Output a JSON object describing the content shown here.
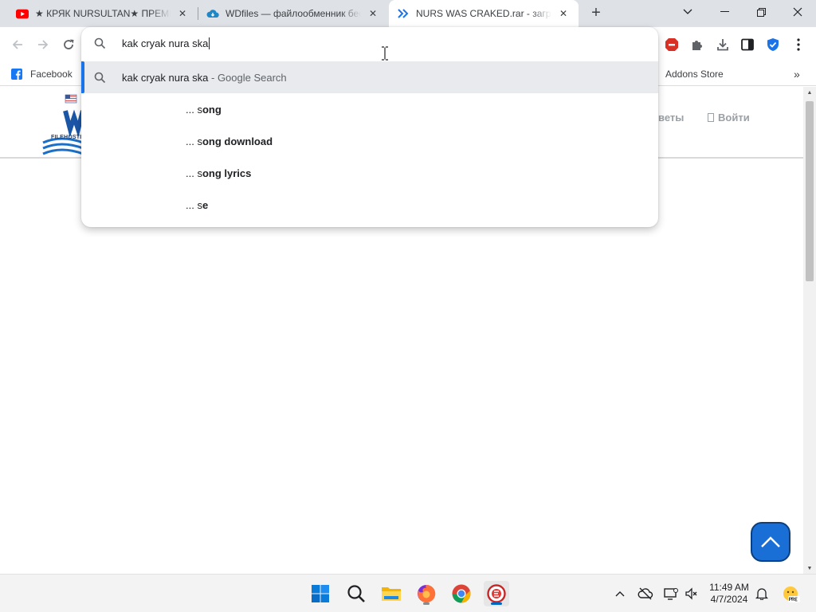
{
  "tabs": [
    {
      "title": "★ КРЯК NURSULTAN★ ПРЕМИУМ",
      "icon": "youtube-icon",
      "active": false
    },
    {
      "title": "WDfiles — файлообменник бесплатный",
      "icon": "cloud-icon",
      "active": false
    },
    {
      "title": "NURS WAS CRAKED.rar - загрузка",
      "icon": "chevrons-icon",
      "active": true
    }
  ],
  "omnibox": {
    "query": "kak cryak nura ska",
    "suggestions": [
      {
        "text": "kak cryak nura ska",
        "suffix": "- Google Search",
        "selected": true
      },
      {
        "prefix": "... s",
        "bold": "ong"
      },
      {
        "prefix": "... s",
        "bold": "ong download"
      },
      {
        "prefix": "... s",
        "bold": "ong lyrics"
      },
      {
        "prefix": "... s",
        "bold": "e"
      }
    ]
  },
  "bookmarks": {
    "facebook": "Facebook",
    "addons": "Addons Store"
  },
  "site": {
    "logo_text": "FILEHOSTI",
    "nav_partial": "веты",
    "login": "Войти"
  },
  "taskbar": {
    "time": "11:49 AM",
    "date": "4/7/2024"
  },
  "colors": {
    "accent": "#1a73e8",
    "to_top_button": "#1a6fd6",
    "tabstrip": "#dee1e6",
    "youtube_red": "#ff0000"
  }
}
